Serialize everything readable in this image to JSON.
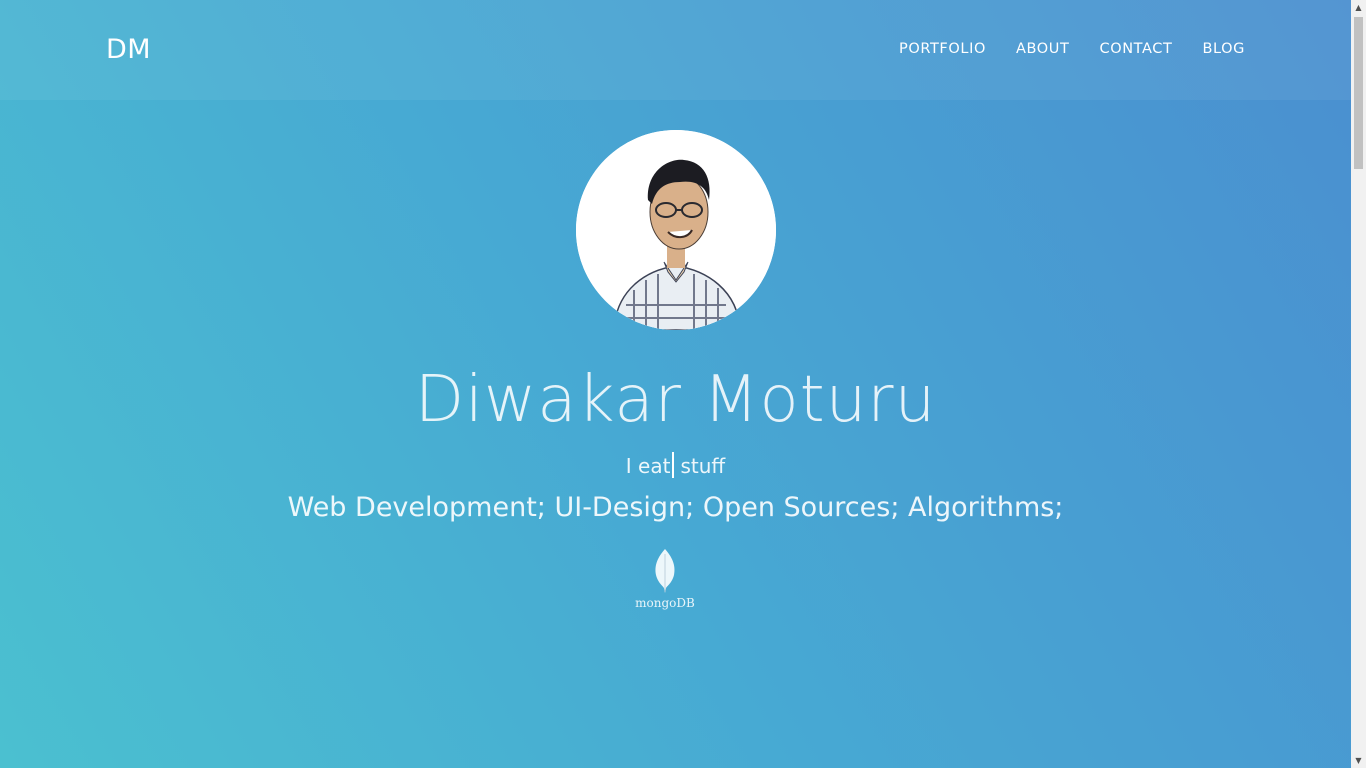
{
  "header": {
    "brand": "DM",
    "nav": [
      "PORTFOLIO",
      "ABOUT",
      "CONTACT",
      "BLOG"
    ]
  },
  "hero": {
    "avatar_icon": "profile-photo",
    "name": "Diwakar Moturu",
    "tagline_prefix": "I eat",
    "tagline_suffix": "stuff",
    "skills": "Web Development; UI-Design; Open Sources; Algorithms;",
    "logo_icon": "mongodb-leaf-icon",
    "logo_label": "mongoDB"
  },
  "colors": {
    "gradient_start": "#4bc0d0",
    "gradient_end": "#4a8fd0",
    "text": "#ffffff"
  }
}
